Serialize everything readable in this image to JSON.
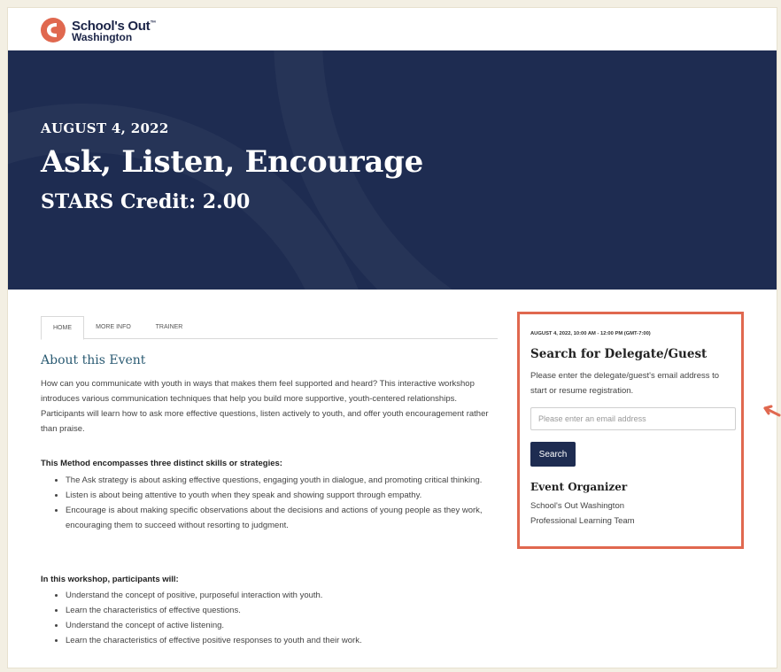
{
  "logo": {
    "line1": "School's Out",
    "trademark": "™",
    "line2": "Washington"
  },
  "hero": {
    "date": "AUGUST 4, 2022",
    "title": "Ask, Listen, Encourage",
    "credit": "STARS Credit: 2.00"
  },
  "tabs": [
    {
      "label": "HOME",
      "active": true
    },
    {
      "label": "MORE INFO",
      "active": false
    },
    {
      "label": "TRAINER",
      "active": false
    }
  ],
  "about": {
    "heading": "About this Event",
    "paragraph": "How can you communicate with youth in ways that makes them feel supported and heard? This interactive workshop introduces various communication techniques that help you build more supportive, youth-centered relationships. Participants will learn how to ask more effective questions, listen actively to youth, and offer youth encouragement rather than praise.",
    "method_heading": "This Method encompasses three distinct skills or strategies:",
    "method_items": [
      "The Ask strategy is about asking effective questions, engaging youth in dialogue, and promoting critical thinking.",
      "Listen is about being attentive to youth when they speak and showing support through empathy.",
      "Encourage is about making specific observations about the decisions and actions of young people as they work, encouraging them to succeed without resorting to judgment."
    ],
    "workshop_heading": "In this workshop, participants will:",
    "workshop_items": [
      "Understand the concept of positive, purposeful interaction with youth.",
      "Learn the characteristics of effective questions.",
      "Understand the concept of active listening.",
      "Learn the characteristics of effective positive responses to youth and their work."
    ]
  },
  "sidebar": {
    "datetime": "AUGUST 4, 2022, 10:00 AM - 12:00 PM (GMT-7:00)",
    "title": "Search for Delegate/Guest",
    "description": "Please enter the delegate/guest's email address to start or resume registration.",
    "email_value": "",
    "email_placeholder": "Please enter an email address",
    "search_label": "Search",
    "organizer_heading": "Event Organizer",
    "organizer_line1": "School's Out Washington",
    "organizer_line2": "Professional Learning Team"
  },
  "colors": {
    "hero_bg": "#1e2c51",
    "accent": "#e0684f",
    "heading_teal": "#2b5b73",
    "page_bg": "#f3efe3"
  },
  "icons": {
    "logo": "sow-logo-icon",
    "annotation": "pointer-arrow-icon"
  }
}
